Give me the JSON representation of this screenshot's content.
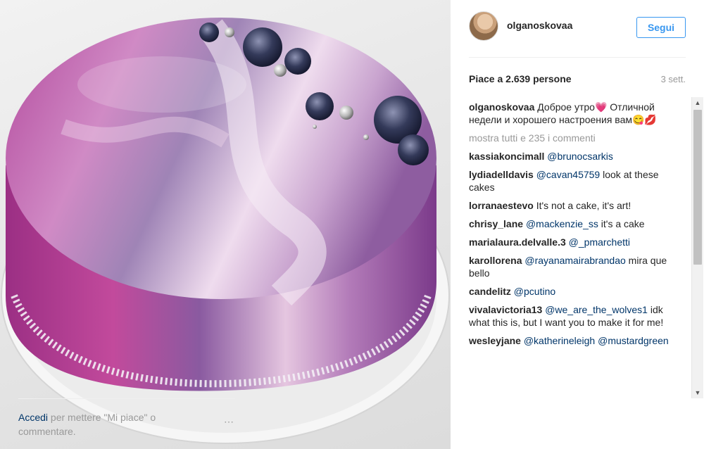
{
  "post": {
    "username": "olganoskovaa",
    "follow_label": "Segui",
    "likes": "Piace a 2.639 persone",
    "time": "3 sett.",
    "caption_user": "olganoskovaa",
    "caption_text": "Доброе утро💗 Отличной недели и хорошего настроения вам😋💋",
    "more_comments": "mostra tutti e 235 i commenti"
  },
  "comments": [
    {
      "user": "kassiakoncimall",
      "mention": "@brunocsarkis",
      "text": ""
    },
    {
      "user": "lydiadelldavis",
      "mention": "@cavan45759",
      "text": " look at these cakes"
    },
    {
      "user": "lorranaestevo",
      "mention": "",
      "text": " It's not a cake, it's art!"
    },
    {
      "user": "chrisy_lane",
      "mention": "@mackenzie_ss",
      "text": " it's a cake"
    },
    {
      "user": "marialaura.delvalle.3",
      "mention": "@_pmarchetti",
      "text": ""
    },
    {
      "user": "karollorena",
      "mention": "@rayanamairabrandao",
      "text": " mira que bello"
    },
    {
      "user": "candelitz",
      "mention": "@pcutino",
      "text": ""
    },
    {
      "user": "vivalavictoria13",
      "mention": "@we_are_the_wolves1",
      "text": " idk what this is, but I want you to make it for me!"
    },
    {
      "user": "wesleyjane",
      "mention": "@katherineleigh @mustardgreen",
      "text": ""
    }
  ],
  "footer": {
    "login": "Accedi",
    "rest": " per mettere \"Mi piace\" o commentare.",
    "more_icon": "⋯"
  },
  "colors": {
    "accent": "#3897f0",
    "link": "#003569",
    "muted": "#999999"
  }
}
